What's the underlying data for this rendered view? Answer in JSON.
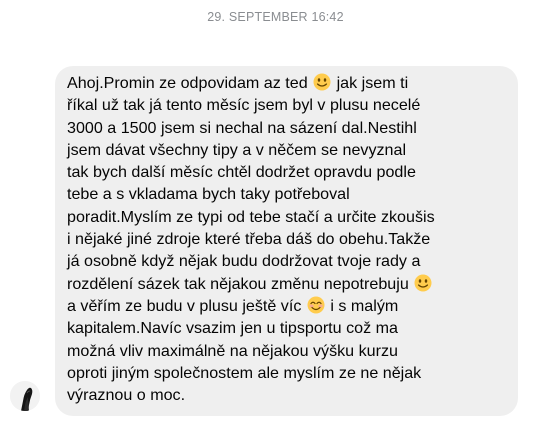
{
  "conversation": {
    "timestamp": "29. SEPTEMBER 16:42",
    "message": {
      "lines": [
        [
          "Ahoj.Promin ze odpovidam az ted ",
          "emoji:smile",
          " jak jsem ti"
        ],
        [
          "říkal už tak já tento měsíc jsem byl v plusu necelé"
        ],
        [
          "3000 a 1500 jsem si nechal na sázení dal.Nestihl"
        ],
        [
          "jsem dávat všechny tipy a v něčem se nevyznal"
        ],
        [
          "tak bych další měsíc chtěl dodržet opravdu podle"
        ],
        [
          "tebe a s vkladama bych taky potřeboval"
        ],
        [
          "poradit.Myslím ze typi od tebe stačí a určite zkoušis"
        ],
        [
          "i nějaké jiné zdroje které třeba dáš do obehu.Takže"
        ],
        [
          "já osobně když nějak budu dodržovat tvoje rady a"
        ],
        [
          "rozdělení sázek tak nějakou změnu nepotrebuju ",
          "emoji:smile"
        ],
        [
          "a věřím ze budu v plusu ještě víc ",
          "emoji:blush",
          " i s malým"
        ],
        [
          "kapitalem.Navíc vsazim jen u tipsportu což ma"
        ],
        [
          "možná vliv maximálně na nějakou výšku kurzu"
        ],
        [
          "oproti jiným společnostem ale myslím ze ne nějak"
        ],
        [
          "výraznou o moc."
        ]
      ]
    }
  },
  "icons": {
    "smile": "slightly-smiling-face-icon",
    "blush": "smiling-face-with-smiling-eyes-icon",
    "avatar": "contact-avatar"
  },
  "colors": {
    "bubble_background": "#efefef",
    "text": "#050505",
    "timestamp": "#8a8d91",
    "emoji_face": "#ffcc4d"
  }
}
